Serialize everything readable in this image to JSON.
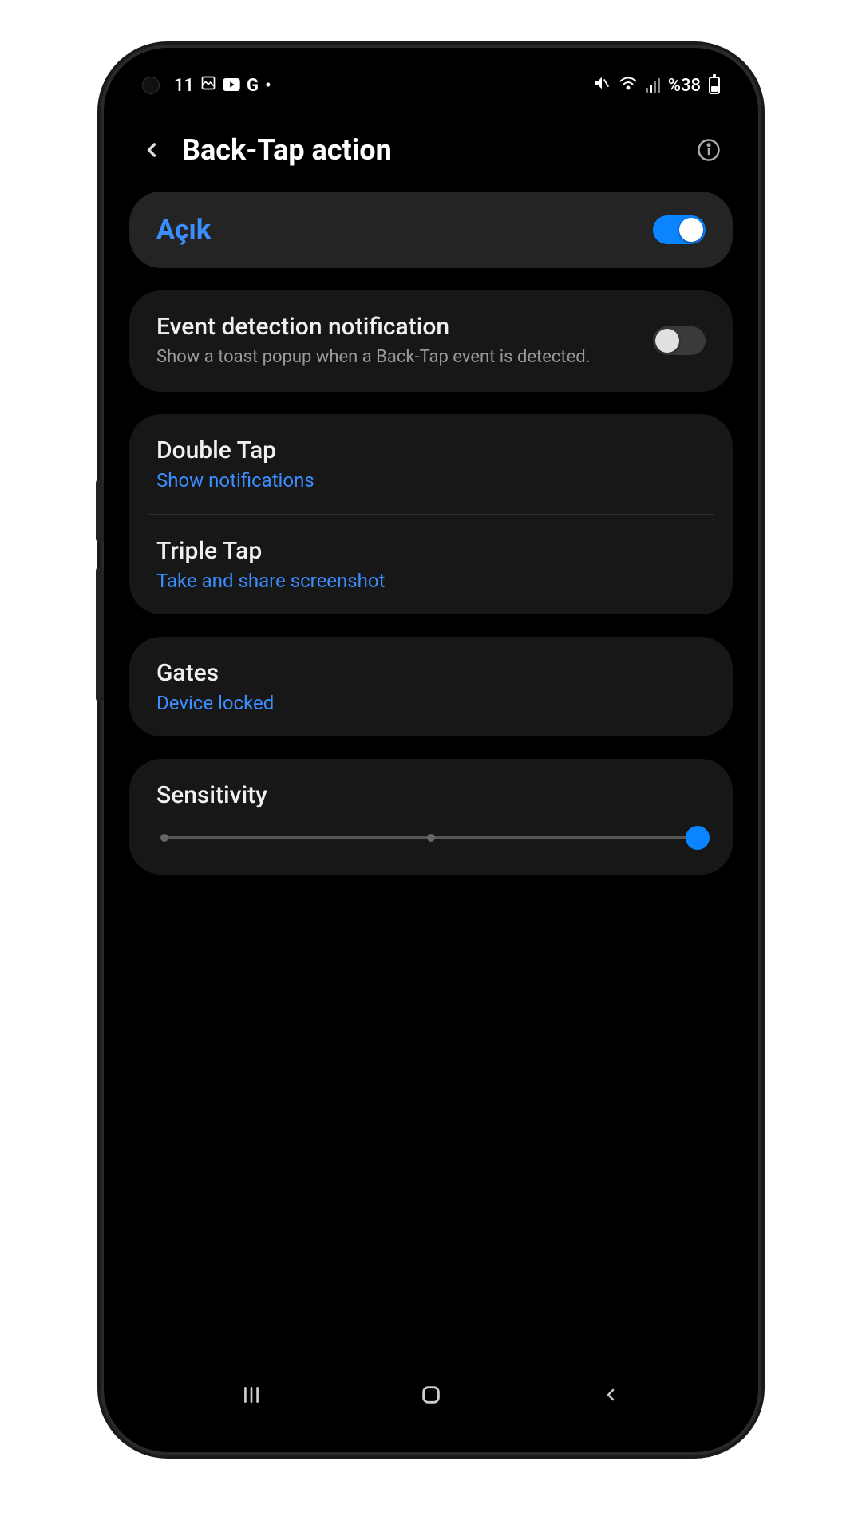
{
  "status": {
    "left_text": "11",
    "left_dot": "•",
    "battery_text": "%38"
  },
  "header": {
    "title": "Back-Tap action"
  },
  "master_toggle": {
    "label": "Açık",
    "on": true
  },
  "event_detection": {
    "title": "Event detection notification",
    "subtitle": "Show a toast popup when a Back-Tap event is detected.",
    "on": false
  },
  "tap_actions": {
    "double": {
      "title": "Double Tap",
      "value": "Show notifications"
    },
    "triple": {
      "title": "Triple Tap",
      "value": "Take and share screenshot"
    }
  },
  "gates": {
    "title": "Gates",
    "value": "Device locked"
  },
  "sensitivity": {
    "title": "Sensitivity",
    "position_percent": 100,
    "ticks_percent": [
      0,
      50,
      100
    ]
  }
}
